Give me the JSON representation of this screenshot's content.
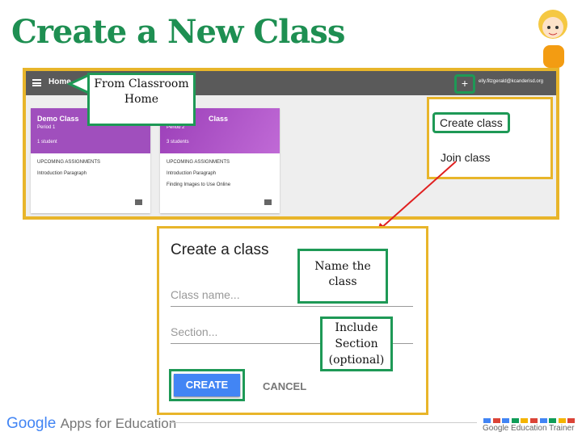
{
  "title": "Create a New Class",
  "classroom": {
    "home_label": "Home",
    "email": "elly.fitzgerald@kcanderisd.org",
    "plus_label": "+",
    "cards": [
      {
        "name": "Demo Class",
        "section": "Period 1",
        "students": "1 student",
        "upcoming": "UPCOMING ASSIGNMENTS",
        "assignments": [
          "Introduction Paragraph"
        ]
      },
      {
        "name": "Class",
        "section": "Period 2",
        "students": "3 students",
        "upcoming": "UPCOMING ASSIGNMENTS",
        "assignments": [
          "Introduction Paragraph",
          "Finding Images to Use Online"
        ]
      }
    ],
    "menu": {
      "create": "Create class",
      "join": "Join class"
    }
  },
  "callouts": {
    "home": "From Classroom Home",
    "name": "Name the class",
    "section": "Include Section (optional)"
  },
  "dialog": {
    "title": "Create a class",
    "class_name_placeholder": "Class name...",
    "section_placeholder": "Section...",
    "create": "CREATE",
    "cancel": "CANCEL"
  },
  "footer": {
    "google": "Google",
    "apps": "Apps for Education",
    "trainer": "Google Education Trainer",
    "squares": [
      "#4285f4",
      "#db4437",
      "#4285f4",
      "#0f9d58",
      "#f4b400",
      "#db4437",
      "#4285f4",
      "#0f9d58",
      "#f4b400",
      "#db4437"
    ]
  },
  "colors": {
    "accent": "#1e9956",
    "frame": "#e8b52a",
    "card": "#a04fbd",
    "arrow": "#e02020"
  }
}
